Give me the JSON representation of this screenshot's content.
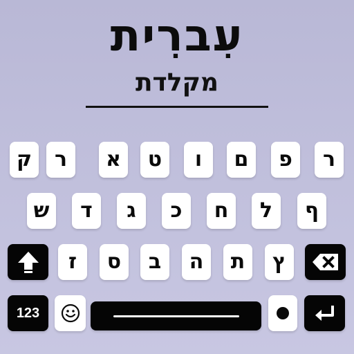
{
  "header": {
    "title": "עִברִית",
    "subtitle": "מקלדת"
  },
  "keyboard": {
    "row1": [
      "ק",
      "ר",
      "א",
      "ט",
      "ו",
      "ם",
      "פ",
      "ר"
    ],
    "row2": [
      "ש",
      "ד",
      "ג",
      "כ",
      "ח",
      "ל",
      "ף"
    ],
    "row3": [
      "ז",
      "ס",
      "ב",
      "ה",
      "ת",
      "ץ"
    ],
    "numbers_label": "123",
    "icons": {
      "shift": "shift-arrow-icon",
      "backspace": "backspace-icon",
      "emoji": "smiley-icon",
      "space": "space-bar",
      "dot": "dot-icon",
      "enter": "enter-return-icon"
    },
    "colors": {
      "key_light": "#ffffff",
      "key_dark": "#050505",
      "background": "#bdbcd9"
    }
  }
}
